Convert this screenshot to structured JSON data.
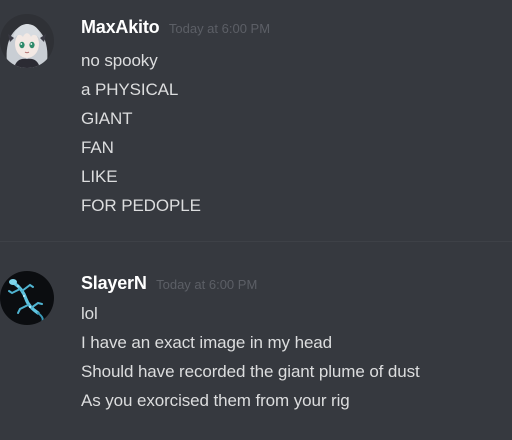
{
  "messages": [
    {
      "username": "MaxAkito",
      "timestamp": "Today at 6:00 PM",
      "avatar_icon": "anime-girl-avatar",
      "lines": [
        "no spooky",
        "a PHYSICAL",
        "GIANT",
        "FAN",
        "LIKE",
        "FOR PEDOPLE"
      ]
    },
    {
      "username": "SlayerN",
      "timestamp": "Today at 6:00 PM",
      "avatar_icon": "blue-lizard-avatar",
      "lines": [
        "lol",
        "I have an exact image in my head",
        "Should have recorded the giant plume of dust",
        "As you exorcised them from your rig"
      ]
    }
  ],
  "colors": {
    "background": "#36393f",
    "username": "#ffffff",
    "timestamp": "#5c5f66",
    "message_text": "#dcddde"
  }
}
